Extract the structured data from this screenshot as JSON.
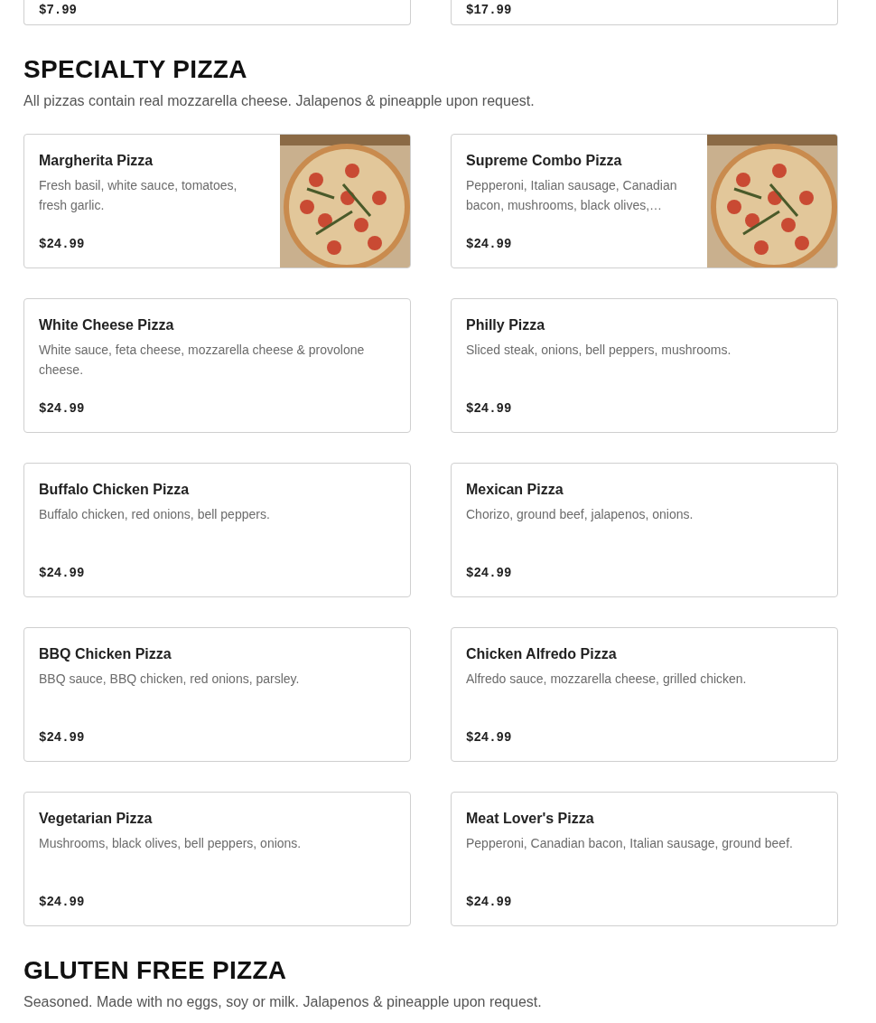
{
  "previous_items": [
    {
      "price": "$7.99"
    },
    {
      "price": "$17.99"
    }
  ],
  "sections": [
    {
      "title": "SPECIALTY PIZZA",
      "note": "All pizzas contain real mozzarella cheese. Jalapenos & pineapple upon request.",
      "items": [
        {
          "name": "Margherita Pizza",
          "description": "Fresh basil, white sauce, tomatoes, fresh garlic.",
          "price": "$24.99"
        },
        {
          "name": "Supreme Combo Pizza",
          "description": "Pepperoni, Italian sausage, Canadian bacon, mushrooms, black olives,…",
          "price": "$24.99"
        },
        {
          "name": "White Cheese Pizza",
          "description": "White sauce, feta cheese, mozzarella cheese & provolone cheese.",
          "price": "$24.99"
        },
        {
          "name": "Philly Pizza",
          "description": "Sliced steak, onions, bell peppers, mushrooms.",
          "price": "$24.99"
        },
        {
          "name": "Buffalo Chicken Pizza",
          "description": "Buffalo chicken, red onions, bell peppers.",
          "price": "$24.99"
        },
        {
          "name": "Mexican Pizza",
          "description": "Chorizo, ground beef, jalapenos, onions.",
          "price": "$24.99"
        },
        {
          "name": "BBQ Chicken Pizza",
          "description": "BBQ sauce, BBQ chicken, red onions, parsley.",
          "price": "$24.99"
        },
        {
          "name": "Chicken Alfredo Pizza",
          "description": "Alfredo sauce, mozzarella cheese, grilled chicken.",
          "price": "$24.99"
        },
        {
          "name": "Vegetarian Pizza",
          "description": "Mushrooms, black olives, bell peppers, onions.",
          "price": "$24.99"
        },
        {
          "name": "Meat Lover's Pizza",
          "description": "Pepperoni, Canadian bacon, Italian sausage, ground beef.",
          "price": "$24.99"
        }
      ]
    },
    {
      "title": "GLUTEN FREE PIZZA",
      "note": "Seasoned. Made with no eggs, soy or milk. Jalapenos & pineapple upon request."
    }
  ]
}
